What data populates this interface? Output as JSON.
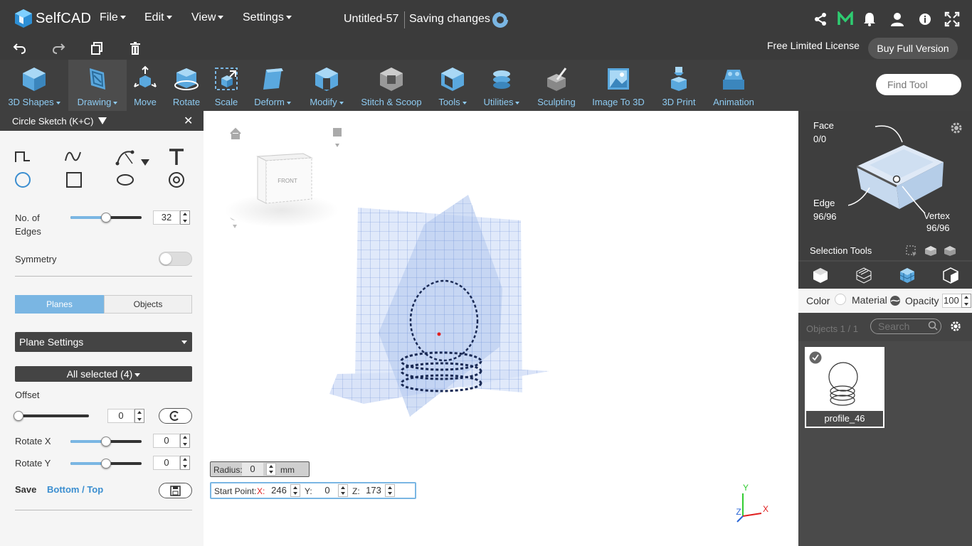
{
  "app": {
    "logo_text": "SelfCAD",
    "menus": [
      "File",
      "Edit",
      "View",
      "Settings"
    ],
    "document_title": "Untitled-57",
    "save_status": "Saving changes"
  },
  "license": {
    "label": "Free Limited License",
    "buy_button": "Buy Full Version"
  },
  "toolbar": {
    "tools": [
      {
        "label": "3D Shapes",
        "dropdown": true
      },
      {
        "label": "Drawing",
        "dropdown": true,
        "active": true
      },
      {
        "label": "Move",
        "dropdown": false
      },
      {
        "label": "Rotate",
        "dropdown": false
      },
      {
        "label": "Scale",
        "dropdown": false
      },
      {
        "label": "Deform",
        "dropdown": true
      },
      {
        "label": "Modify",
        "dropdown": true
      },
      {
        "label": "Stitch & Scoop",
        "dropdown": false
      },
      {
        "label": "Tools",
        "dropdown": true
      },
      {
        "label": "Utilities",
        "dropdown": true
      },
      {
        "label": "Sculpting",
        "dropdown": false
      },
      {
        "label": "Image To 3D",
        "dropdown": false
      },
      {
        "label": "3D Print",
        "dropdown": false
      },
      {
        "label": "Animation",
        "dropdown": false
      }
    ],
    "find_tool_placeholder": "Find Tool"
  },
  "left_panel": {
    "title": "Circle Sketch (K+C)",
    "edges_label": "No. of Edges",
    "edges_value": "32",
    "edges_slider": 0.5,
    "symmetry_label": "Symmetry",
    "symmetry_on": false,
    "segments": [
      "Planes",
      "Objects"
    ],
    "active_segment": "Planes",
    "plane_settings": "Plane Settings",
    "all_selected": "All selected (4)",
    "offset_label": "Offset",
    "offset_value": "0",
    "offset_slider": 0.0,
    "rotate_x_label": "Rotate X",
    "rotate_x_value": "0",
    "rotate_x_slider": 0.5,
    "rotate_y_label": "Rotate Y",
    "rotate_y_value": "0",
    "rotate_y_slider": 0.5,
    "save_label": "Save",
    "save_target": "Bottom / Top"
  },
  "viewport": {
    "view_cube_label": "FRONT",
    "radius_label": "Radius:",
    "radius_value": "0",
    "radius_unit": "mm",
    "start_point_label": "Start Point:",
    "x_label": "X:",
    "x_value": "246",
    "y_label": "Y:",
    "y_value": "0",
    "z_label": "Z:",
    "z_value": "173",
    "axis_labels": {
      "x": "X",
      "y": "Y",
      "z": "Z"
    }
  },
  "right_panel": {
    "face_label": "Face",
    "face_count": "0/0",
    "edge_label": "Edge",
    "edge_count": "96/96",
    "vertex_label": "Vertex",
    "vertex_count": "96/96",
    "selection_tools": "Selection Tools",
    "color_label": "Color",
    "material_label": "Material",
    "opacity_label": "Opacity",
    "opacity_value": "100",
    "objects_count": "Objects 1 / 1",
    "search_placeholder": "Search",
    "object_name": "profile_46"
  },
  "colors": {
    "accent": "#7ab6e3",
    "toolbar_label": "#8ecbf2",
    "dark_bg": "#3b3b3b"
  }
}
